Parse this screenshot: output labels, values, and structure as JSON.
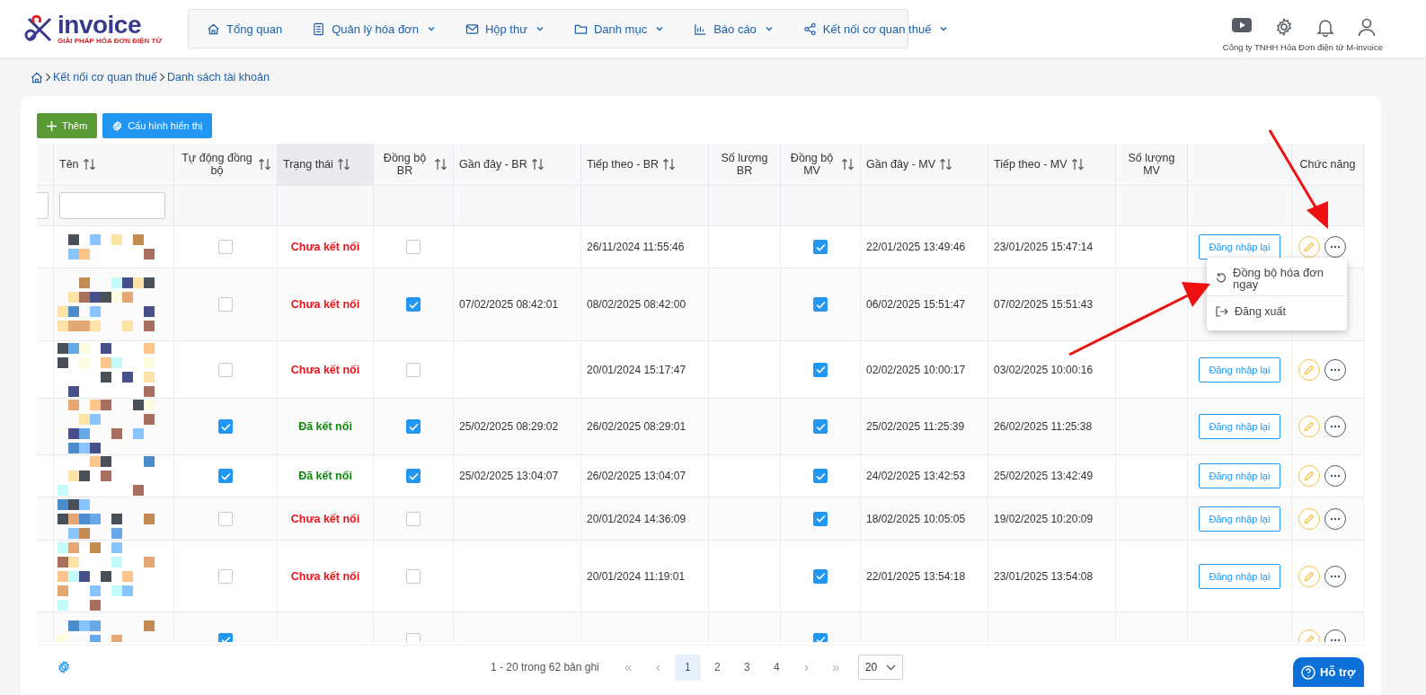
{
  "brand": {
    "name": "invoice",
    "tagline": "GIẢI PHÁP HÓA ĐƠN ĐIỆN TỬ"
  },
  "nav": [
    {
      "label": "Tổng quan",
      "has_menu": false
    },
    {
      "label": "Quản lý hóa đơn",
      "has_menu": true
    },
    {
      "label": "Hộp thư",
      "has_menu": true
    },
    {
      "label": "Danh mục",
      "has_menu": true
    },
    {
      "label": "Báo cáo",
      "has_menu": true
    },
    {
      "label": "Kết nối cơ quan thuế",
      "has_menu": true
    }
  ],
  "company": "Công ty TNHH Hóa Đơn điện tử M-invoice",
  "breadcrumb": [
    "Kết nối cơ quan thuế",
    "Danh sách tài khoản"
  ],
  "toolbar": {
    "add": "Thêm",
    "configure": "Cấu hình hiển thị"
  },
  "table": {
    "columns": [
      {
        "sortable": false,
        "highlighted": false
      },
      {
        "label": "Tên",
        "sortable": true,
        "highlighted": false
      },
      {
        "label": "Tự động đồng bộ",
        "sortable": true,
        "highlighted": false
      },
      {
        "label": "Trạng thái",
        "sortable": true,
        "highlighted": true
      },
      {
        "label": "Đồng bộ BR",
        "sortable": true,
        "highlighted": false
      },
      {
        "label": "Gần đây - BR",
        "sortable": true,
        "highlighted": false
      },
      {
        "label": "Tiếp theo - BR",
        "sortable": true,
        "highlighted": false
      },
      {
        "label": "Số lượng BR",
        "sortable": false,
        "highlighted": false
      },
      {
        "label": "Đồng bộ MV",
        "sortable": true,
        "highlighted": false
      },
      {
        "label": "Gần đây - MV",
        "sortable": true,
        "highlighted": false
      },
      {
        "label": "Tiếp theo - MV",
        "sortable": true,
        "highlighted": false
      },
      {
        "label": "Số lượng MV",
        "sortable": false,
        "highlighted": false
      },
      {
        "sortable": false,
        "highlighted": false
      },
      {
        "label": "Chức năng",
        "sortable": false,
        "highlighted": false
      }
    ],
    "rows": [
      {
        "auto_sync": false,
        "status": "Chưa kết nối",
        "connected": false,
        "sync_br": false,
        "br_next": "26/11/2024 11:55:46",
        "sync_mv": true,
        "mv_recent": "22/01/2025 13:49:46",
        "mv_next": "23/01/2025 15:47:14",
        "relogin": "Đăng nhập lại"
      },
      {
        "auto_sync": false,
        "status": "Chưa kết nối",
        "connected": false,
        "sync_br": true,
        "br_recent": "07/02/2025 08:42:01",
        "br_next": "08/02/2025 08:42:00",
        "sync_mv": true,
        "mv_recent": "06/02/2025 15:51:47",
        "mv_next": "07/02/2025 15:51:43"
      },
      {
        "auto_sync": false,
        "status": "Chưa kết nối",
        "connected": false,
        "sync_br": false,
        "br_next": "20/01/2024 15:17:47",
        "sync_mv": true,
        "mv_recent": "02/02/2025 10:00:17",
        "mv_next": "03/02/2025 10:00:16",
        "relogin": "Đăng nhập lại"
      },
      {
        "auto_sync": true,
        "status": "Đã kết nối",
        "connected": true,
        "sync_br": true,
        "br_recent": "25/02/2025 08:29:02",
        "br_next": "26/02/2025 08:29:01",
        "sync_mv": true,
        "mv_recent": "25/02/2025 11:25:39",
        "mv_next": "26/02/2025 11:25:38",
        "relogin": "Đăng nhập lại"
      },
      {
        "auto_sync": true,
        "status": "Đã kết nối",
        "connected": true,
        "sync_br": true,
        "br_recent": "25/02/2025 13:04:07",
        "br_next": "26/02/2025 13:04:07",
        "sync_mv": true,
        "mv_recent": "24/02/2025 13:42:53",
        "mv_next": "25/02/2025 13:42:49",
        "relogin": "Đăng nhập lại"
      },
      {
        "auto_sync": false,
        "status": "Chưa kết nối",
        "connected": false,
        "sync_br": false,
        "br_next": "20/01/2024 14:36:09",
        "sync_mv": true,
        "mv_recent": "18/02/2025 10:05:05",
        "mv_next": "19/02/2025 10:20:09",
        "relogin": "Đăng nhập lại"
      },
      {
        "auto_sync": false,
        "status": "Chưa kết nối",
        "connected": false,
        "sync_br": false,
        "br_next": "20/01/2024 11:19:01",
        "sync_mv": true,
        "mv_recent": "22/01/2025 13:54:18",
        "mv_next": "23/01/2025 13:54:08",
        "relogin": "Đăng nhập lại"
      },
      {
        "auto_sync": true,
        "sync_br": false,
        "sync_mv": true
      }
    ]
  },
  "row_menu": {
    "open": true,
    "items": [
      {
        "label": "Đồng bộ hóa đơn ngay"
      },
      {
        "label": "Đăng xuất"
      }
    ]
  },
  "pagination": {
    "summary": "1 - 20 trong 62 bản ghi",
    "first": "«",
    "prev": "‹",
    "pages": [
      {
        "label": "1",
        "selected": true
      },
      {
        "label": "2",
        "selected": false
      },
      {
        "label": "3",
        "selected": false
      },
      {
        "label": "4",
        "selected": false
      }
    ],
    "next": "›",
    "last": "»",
    "page_size": "20"
  },
  "help": "Hỗ trợ"
}
